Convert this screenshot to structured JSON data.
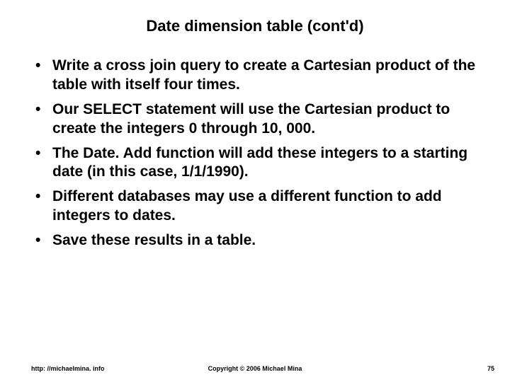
{
  "title": "Date dimension table (cont'd)",
  "bullets": [
    "Write a cross join query to create a Cartesian product of the table with itself four times.",
    "Our SELECT statement will use the Cartesian product to create the integers 0 through 10, 000.",
    "The Date. Add function will add these integers to a starting date (in this case, 1/1/1990).",
    "Different databases may use a different function to add integers to dates.",
    "Save these results in a table."
  ],
  "footer": {
    "left": "http: //michaelmina. info",
    "center": "Copyright © 2006 Michael Mina",
    "right": "75"
  }
}
